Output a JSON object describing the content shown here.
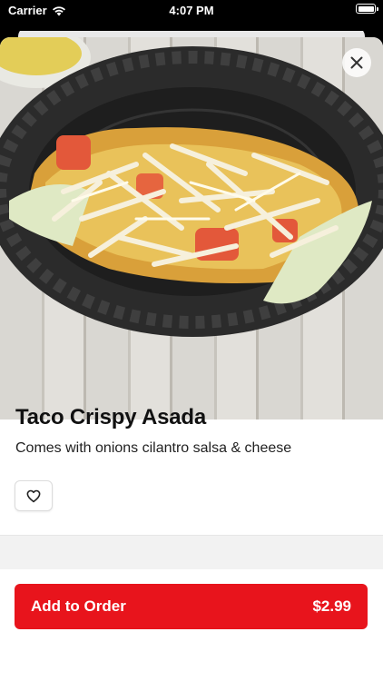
{
  "status_bar": {
    "carrier": "Carrier",
    "time": "4:07 PM"
  },
  "item": {
    "title": "Taco Crispy Asada",
    "description": "Comes with onions cilantro salsa & cheese",
    "photo_icon": "taco-photo"
  },
  "actions": {
    "favorite_icon": "heart-icon",
    "close_icon": "close-icon",
    "add_label": "Add to Order",
    "price": "$2.99"
  },
  "colors": {
    "accent": "#e8141c"
  }
}
